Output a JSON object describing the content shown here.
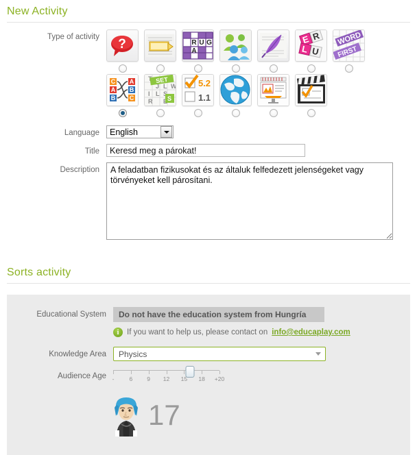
{
  "sections": {
    "new_activity": {
      "title": "New Activity"
    },
    "sorts_activity": {
      "title": "Sorts activity"
    }
  },
  "type_of_activity": {
    "label": "Type of activity",
    "icons_row1": [
      {
        "name": "quiz-icon",
        "selected": false
      },
      {
        "name": "flashcard-icon",
        "selected": false
      },
      {
        "name": "crossword-icon",
        "selected": false
      },
      {
        "name": "matching-people-icon",
        "selected": false
      },
      {
        "name": "quill-dictation-icon",
        "selected": false
      },
      {
        "name": "letter-tiles-icon",
        "selected": false
      },
      {
        "name": "word-search-icon",
        "selected": false
      }
    ],
    "icons_row2": [
      {
        "name": "relate-pairs-icon",
        "selected": true
      },
      {
        "name": "alphabet-soup-icon",
        "selected": false
      },
      {
        "name": "fill-blanks-icon",
        "selected": false
      },
      {
        "name": "map-quiz-icon",
        "selected": false
      },
      {
        "name": "slideshow-icon",
        "selected": false
      },
      {
        "name": "video-quiz-icon",
        "selected": false
      }
    ]
  },
  "language": {
    "label": "Language",
    "value": "English"
  },
  "title_field": {
    "label": "Title",
    "value": "Keresd meg a párokat!",
    "placeholder": ""
  },
  "description_field": {
    "label": "Description",
    "value": "A feladatban fizikusokat és az általuk felfedezett jelenségeket vagy törvényeket kell párosítani.",
    "placeholder": ""
  },
  "educational_system": {
    "label": "Educational System",
    "value": "Do not have the education system from Hungría",
    "help_text": "If you want to help us, please contact on",
    "help_link": "info@educaplay.com"
  },
  "knowledge_area": {
    "label": "Knowledge Area",
    "value": "Physics"
  },
  "audience_age": {
    "label": "Audience Age",
    "ticks": [
      "-",
      "6",
      "9",
      "12",
      "15",
      "18",
      "+20"
    ],
    "value": "17",
    "knob_percent": 72
  },
  "colors": {
    "accent_green": "#8cb224",
    "panel_grey": "#ebebeb",
    "readonly_grey": "#c8c8c8",
    "label_grey": "#666666"
  }
}
